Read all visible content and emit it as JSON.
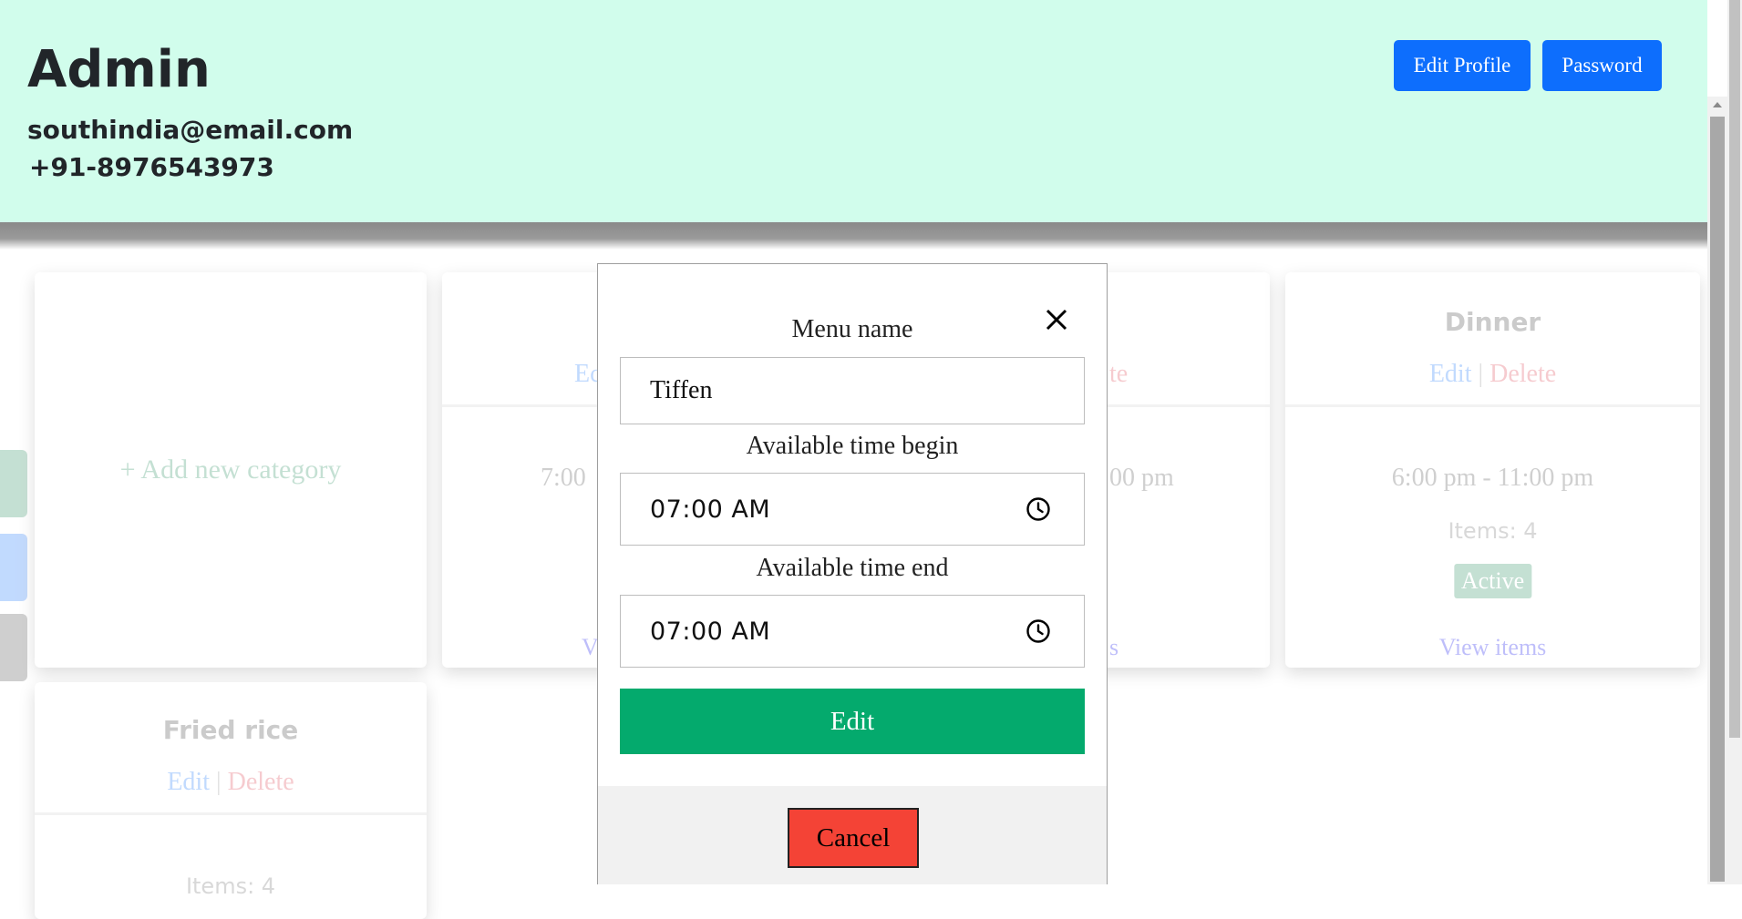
{
  "header": {
    "title": "Admin",
    "email": "southindia@email.com",
    "phone": "+91-8976543973",
    "edit_profile_label": "Edit Profile",
    "password_label": "Password"
  },
  "menu_cards": {
    "add_label": "+ Add new category",
    "card2": {
      "edit_partial": "Ec",
      "time_partial": "7:00",
      "view_partial": "V"
    },
    "card3": {
      "delete_partial": "te",
      "time_partial": "00 pm",
      "view_partial": "s"
    },
    "dinner": {
      "title": "Dinner",
      "edit": "Edit",
      "sep": "|",
      "delete": "Delete",
      "time": "6:00 pm - 11:00 pm",
      "items": "Items: 4",
      "status": "Active",
      "view": "View items"
    },
    "fried_rice": {
      "title": "Fried rice",
      "edit": "Edit",
      "sep": "|",
      "delete": "Delete",
      "items": "Items: 4"
    }
  },
  "modal": {
    "menu_name_label": "Menu name",
    "menu_name_value": "Tiffen",
    "time_begin_label": "Available time begin",
    "time_begin_value": "07:00 AM",
    "time_end_label": "Available time end",
    "time_end_value": "07:00 AM",
    "submit_label": "Edit",
    "cancel_label": "Cancel"
  },
  "colors": {
    "header_bg": "#d1fdec",
    "primary": "#0d6efd",
    "submit_green": "#04aa6d",
    "cancel_red": "#f44336"
  }
}
